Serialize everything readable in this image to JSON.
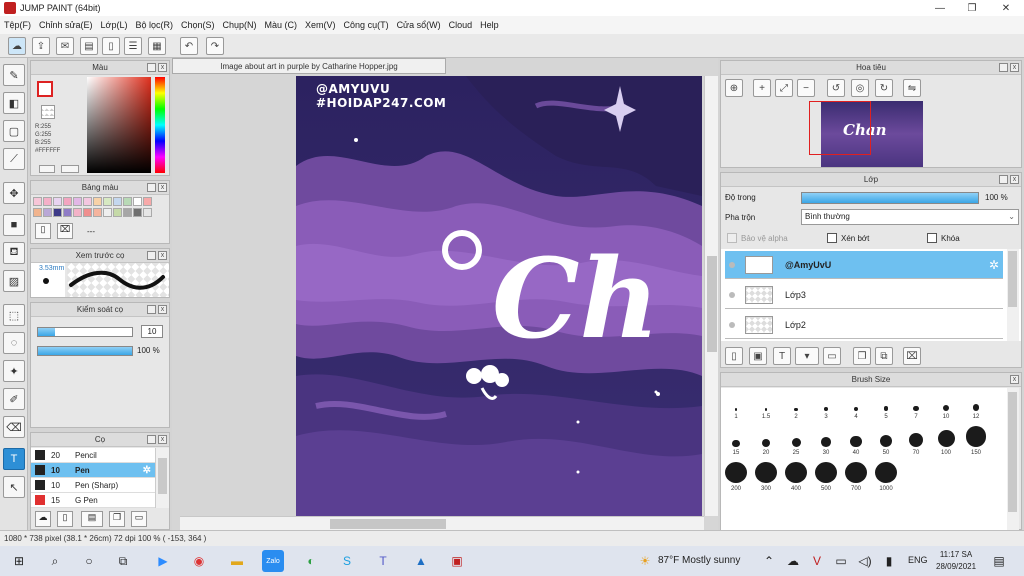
{
  "window": {
    "title": "JUMP PAINT (64bit)",
    "controls": [
      "—",
      "❐",
      "✕"
    ]
  },
  "menu": [
    "Tệp(F)",
    "Chỉnh sửa(E)",
    "Lớp(L)",
    "Bộ lọc(R)",
    "Chọn(S)",
    "Chụp(N)",
    "Màu (C)",
    "Xem(V)",
    "Công cụ(T)",
    "Cửa sổ(W)",
    "Cloud",
    "Help"
  ],
  "canvas": {
    "tab_title": "Image about art in purple by Catharine Hopper.jpg",
    "watermark_line1": "@AMYUVU",
    "watermark_line2": "#HOIDAP247.COM",
    "art_text": "Ch"
  },
  "color_panel": {
    "title": "Màu",
    "r": "R:255",
    "g": "G:255",
    "b": "B:255",
    "hex": "#FFFFFF"
  },
  "swatch_panel": {
    "title": "Bảng màu",
    "dash": "---",
    "swatches": [
      "#f7c6d8",
      "#f5b0c8",
      "#e8d3f0",
      "#f2a5c0",
      "#e2b7e6",
      "#f4c7e0",
      "#f8d2a8",
      "#d7e9c2",
      "#c4d7ee",
      "#b8d9b6",
      "#ffffff",
      "#f7a9a9",
      "#f1b48e",
      "#b9a7d6",
      "#3d3a88",
      "#8f7cc6",
      "#f3b2c7",
      "#ef8f8f",
      "#f5b49e",
      "#efefef",
      "#c5d9a8",
      "#a6a6a6",
      "#6f6f6f",
      "#e6e6e6"
    ]
  },
  "brush_preview": {
    "title": "Xem trước cọ",
    "size": "3.53mm"
  },
  "control_panel": {
    "title": "Kiểm soát cọ",
    "size_value": "10",
    "opacity_value": "100 %"
  },
  "brushes": {
    "title": "Cọ",
    "items": [
      {
        "size": "20",
        "name": "Pencil",
        "color": "#222222",
        "selected": false
      },
      {
        "size": "10",
        "name": "Pen",
        "color": "#222222",
        "selected": true
      },
      {
        "size": "10",
        "name": "Pen (Sharp)",
        "color": "#222222",
        "selected": false
      },
      {
        "size": "15",
        "name": "G Pen",
        "color": "#e03030",
        "selected": false
      }
    ]
  },
  "navigator": {
    "title": "Hoa tiêu",
    "thumb_text": "Chan"
  },
  "layer_panel": {
    "title": "Lớp",
    "opacity_label": "Độ trong",
    "opacity_value": "100 %",
    "blend_label": "Pha trộn",
    "blend_value": "Bình thường",
    "protect_alpha": "Bảo vệ alpha",
    "clip": "Xén bớt",
    "lock": "Khóa",
    "layers": [
      {
        "name": "@AmyUvU",
        "selected": true
      },
      {
        "name": "Lớp3",
        "selected": false
      },
      {
        "name": "Lớp2",
        "selected": false
      }
    ]
  },
  "brush_size": {
    "title": "Brush Size",
    "sizes": [
      "1",
      "1.5",
      "2",
      "3",
      "4",
      "5",
      "7",
      "10",
      "12",
      "15",
      "20",
      "25",
      "30",
      "40",
      "50",
      "70",
      "100",
      "150",
      "200",
      "300",
      "400",
      "500",
      "700",
      "1000"
    ]
  },
  "status": {
    "text": "1080 * 738 pixel   (38.1 * 26cm)   72 dpi   100 %   ( -153, 364 )"
  },
  "taskbar": {
    "weather": "87°F  Mostly sunny",
    "lang": "ENG",
    "time": "11:17 SA",
    "date": "28/09/2021"
  }
}
